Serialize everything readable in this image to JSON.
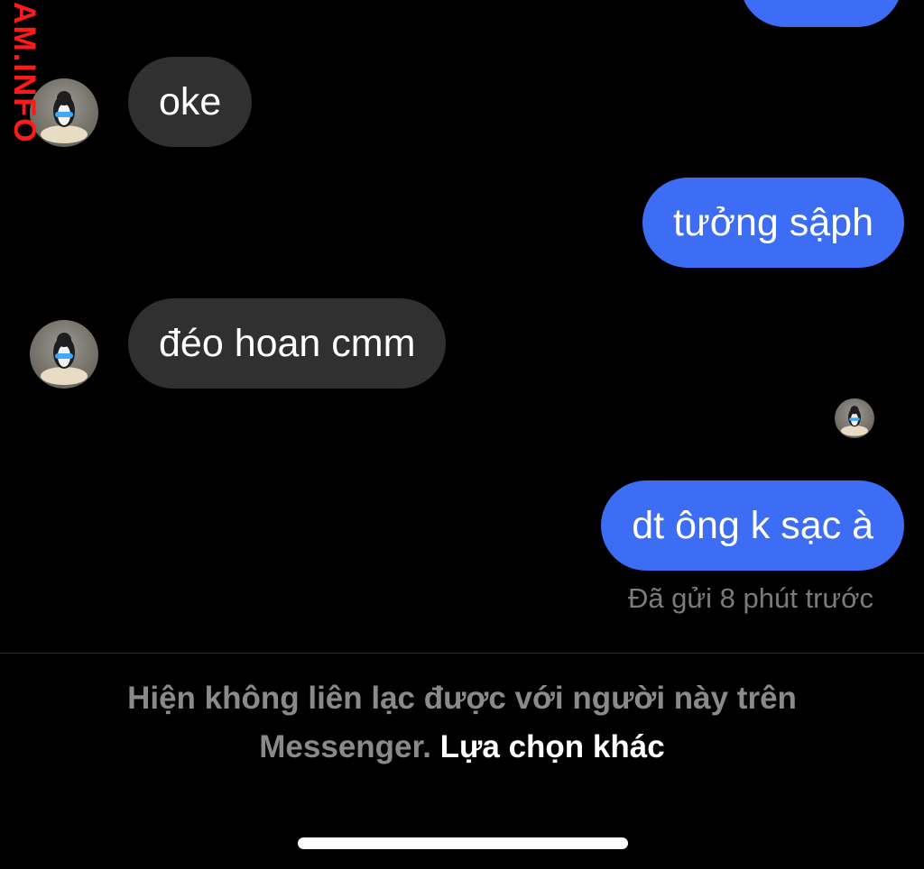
{
  "watermark": {
    "text": "AM.INFO"
  },
  "messages": [
    {
      "direction": "outgoing",
      "text": ""
    },
    {
      "direction": "incoming",
      "text": "oke"
    },
    {
      "direction": "outgoing",
      "text": "tưởng sậph"
    },
    {
      "direction": "incoming",
      "text": "đéo hoan cmm"
    },
    {
      "direction": "outgoing",
      "text": "dt ông k sạc à"
    }
  ],
  "status": {
    "sent_text": "Đã gửi 8 phút trước"
  },
  "notice": {
    "text": "Hiện không liên lạc được với người này trên Messenger.",
    "line1": "Hiện không liên lạc được với người này trên",
    "line2": "Messenger.",
    "link": "Lựa chọn khác"
  },
  "icons": {
    "avatar": "contact-avatar-icon",
    "read_receipt": "seen-avatar-icon"
  },
  "colors": {
    "background": "#000000",
    "incoming_bubble": "#303030",
    "outgoing_bubble": "#3d6cf5",
    "watermark": "#ff1a1a"
  }
}
